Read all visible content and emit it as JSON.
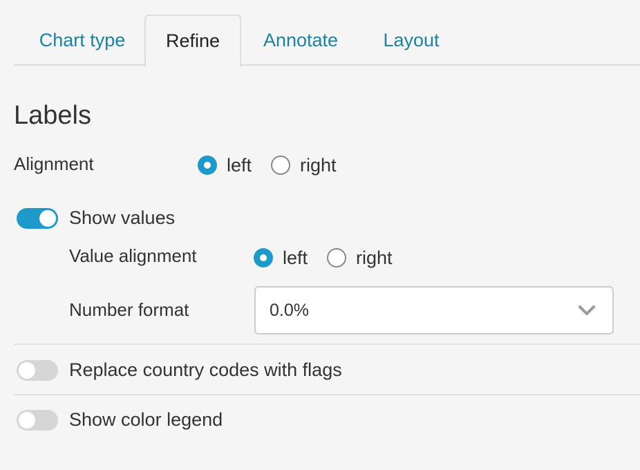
{
  "tabs": [
    {
      "label": "Chart type",
      "active": false
    },
    {
      "label": "Refine",
      "active": true
    },
    {
      "label": "Annotate",
      "active": false
    },
    {
      "label": "Layout",
      "active": false
    }
  ],
  "section_title": "Labels",
  "alignment": {
    "label": "Alignment",
    "options": [
      "left",
      "right"
    ],
    "selected": "left"
  },
  "show_values": {
    "label": "Show values",
    "enabled": true,
    "value_alignment": {
      "label": "Value alignment",
      "options": [
        "left",
        "right"
      ],
      "selected": "left"
    },
    "number_format": {
      "label": "Number format",
      "value": "0.0%"
    }
  },
  "replace_flags": {
    "label": "Replace country codes with flags",
    "enabled": false
  },
  "color_legend": {
    "label": "Show color legend",
    "enabled": false
  },
  "colors": {
    "accent": "#1d9ac9",
    "tab_link": "#1d81a2"
  },
  "icons": {
    "select_chevron": "chevron-down-icon"
  }
}
